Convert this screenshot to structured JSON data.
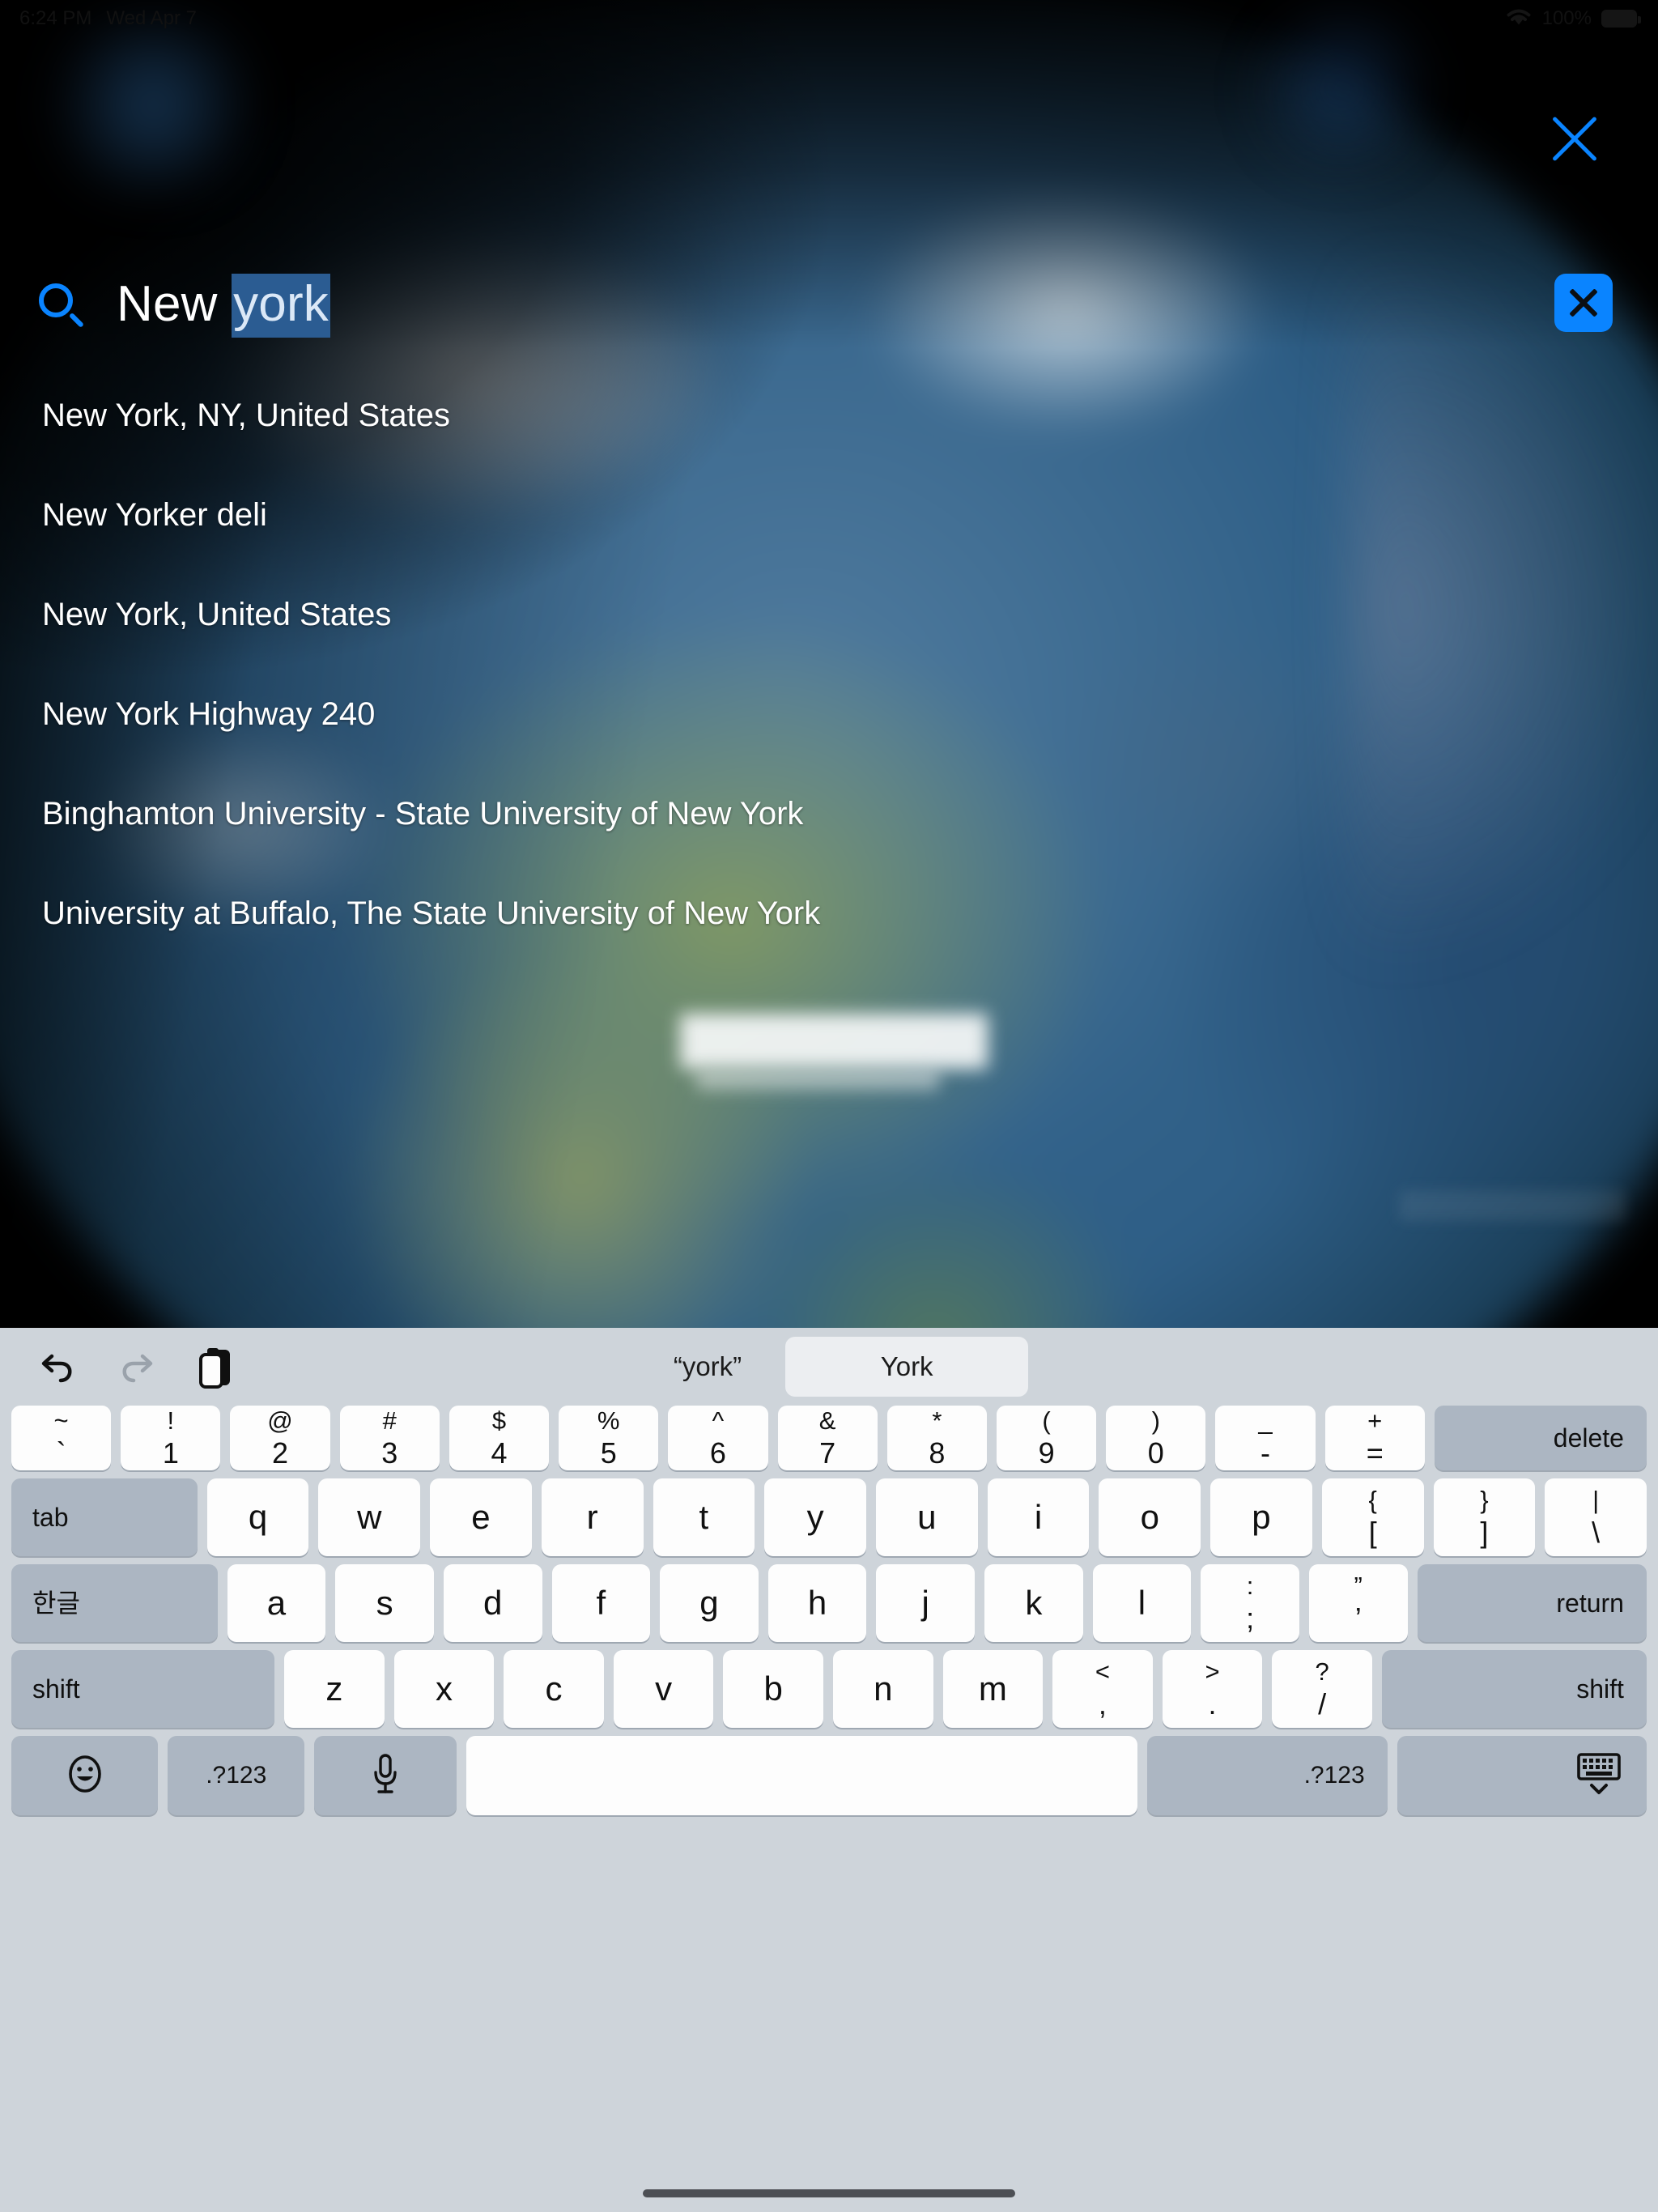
{
  "statusbar": {
    "time": "6:24 PM",
    "date": "Wed Apr 7",
    "battery_percent": "100%",
    "wifi_icon": "wifi-icon",
    "battery_icon": "battery-full-icon"
  },
  "close_button": {
    "icon": "close-icon",
    "label": "Close"
  },
  "search": {
    "icon": "search-icon",
    "text_plain": "New ",
    "text_selected": "york",
    "full_value": "New york",
    "clear_icon": "clear-text-icon",
    "accent_color": "#0a84ff",
    "selection_color": "#2b5c92"
  },
  "suggestions": [
    {
      "label": "New York, NY, United States"
    },
    {
      "label": "New Yorker deli"
    },
    {
      "label": "New York, United States"
    },
    {
      "label": "New York Highway 240"
    },
    {
      "label": "Binghamton University - State University of New York"
    },
    {
      "label": "University at Buffalo, The State University of New York"
    }
  ],
  "keyboard": {
    "toolbar": {
      "undo_icon": "undo-icon",
      "redo_icon": "redo-icon",
      "paste_icon": "paste-icon",
      "literal_candidate": "“york”",
      "suggested_candidate": "York"
    },
    "rows": {
      "number": [
        {
          "name": "key-backtick",
          "top": "~",
          "bot": "`"
        },
        {
          "name": "key-1",
          "top": "!",
          "bot": "1"
        },
        {
          "name": "key-2",
          "top": "@",
          "bot": "2"
        },
        {
          "name": "key-3",
          "top": "#",
          "bot": "3"
        },
        {
          "name": "key-4",
          "top": "$",
          "bot": "4"
        },
        {
          "name": "key-5",
          "top": "%",
          "bot": "5"
        },
        {
          "name": "key-6",
          "top": "^",
          "bot": "6"
        },
        {
          "name": "key-7",
          "top": "&",
          "bot": "7"
        },
        {
          "name": "key-8",
          "top": "*",
          "bot": "8"
        },
        {
          "name": "key-9",
          "top": "(",
          "bot": "9"
        },
        {
          "name": "key-0",
          "top": ")",
          "bot": "0"
        },
        {
          "name": "key-minus",
          "top": "_",
          "bot": "-"
        },
        {
          "name": "key-equal",
          "top": "+",
          "bot": "="
        }
      ],
      "delete_label": "delete",
      "tab_label": "tab",
      "qwerty": [
        {
          "name": "key-q",
          "label": "q"
        },
        {
          "name": "key-w",
          "label": "w"
        },
        {
          "name": "key-e",
          "label": "e"
        },
        {
          "name": "key-r",
          "label": "r"
        },
        {
          "name": "key-t",
          "label": "t"
        },
        {
          "name": "key-y",
          "label": "y"
        },
        {
          "name": "key-u",
          "label": "u"
        },
        {
          "name": "key-i",
          "label": "i"
        },
        {
          "name": "key-o",
          "label": "o"
        },
        {
          "name": "key-p",
          "label": "p"
        }
      ],
      "qwerty_brackets": [
        {
          "name": "key-bracket-left",
          "top": "{",
          "bot": "["
        },
        {
          "name": "key-bracket-right",
          "top": "}",
          "bot": "]"
        },
        {
          "name": "key-backslash",
          "top": "|",
          "bot": "\\"
        }
      ],
      "hangul_label": "한글",
      "home": [
        {
          "name": "key-a",
          "label": "a"
        },
        {
          "name": "key-s",
          "label": "s"
        },
        {
          "name": "key-d",
          "label": "d"
        },
        {
          "name": "key-f",
          "label": "f"
        },
        {
          "name": "key-g",
          "label": "g"
        },
        {
          "name": "key-h",
          "label": "h"
        },
        {
          "name": "key-j",
          "label": "j"
        },
        {
          "name": "key-k",
          "label": "k"
        },
        {
          "name": "key-l",
          "label": "l"
        }
      ],
      "home_punct": [
        {
          "name": "key-semicolon",
          "top": ":",
          "bot": ";"
        },
        {
          "name": "key-quote",
          "top": "”",
          "bot": "’"
        }
      ],
      "return_label": "return",
      "shift_left_label": "shift",
      "shift_right_label": "shift",
      "bottom": [
        {
          "name": "key-z",
          "label": "z"
        },
        {
          "name": "key-x",
          "label": "x"
        },
        {
          "name": "key-c",
          "label": "c"
        },
        {
          "name": "key-v",
          "label": "v"
        },
        {
          "name": "key-b",
          "label": "b"
        },
        {
          "name": "key-n",
          "label": "n"
        },
        {
          "name": "key-m",
          "label": "m"
        }
      ],
      "bottom_punct": [
        {
          "name": "key-comma",
          "top": "<",
          "bot": ","
        },
        {
          "name": "key-period",
          "top": ">",
          "bot": "."
        },
        {
          "name": "key-slash",
          "top": "?",
          "bot": "/"
        }
      ],
      "space_row": {
        "emoji_icon": "emoji-smiley-icon",
        "numeric_left_label": ".?123",
        "mic_icon": "microphone-icon",
        "space_label": "",
        "numeric_right_label": ".?123",
        "hide_keyboard_icon": "hide-keyboard-icon"
      }
    }
  }
}
